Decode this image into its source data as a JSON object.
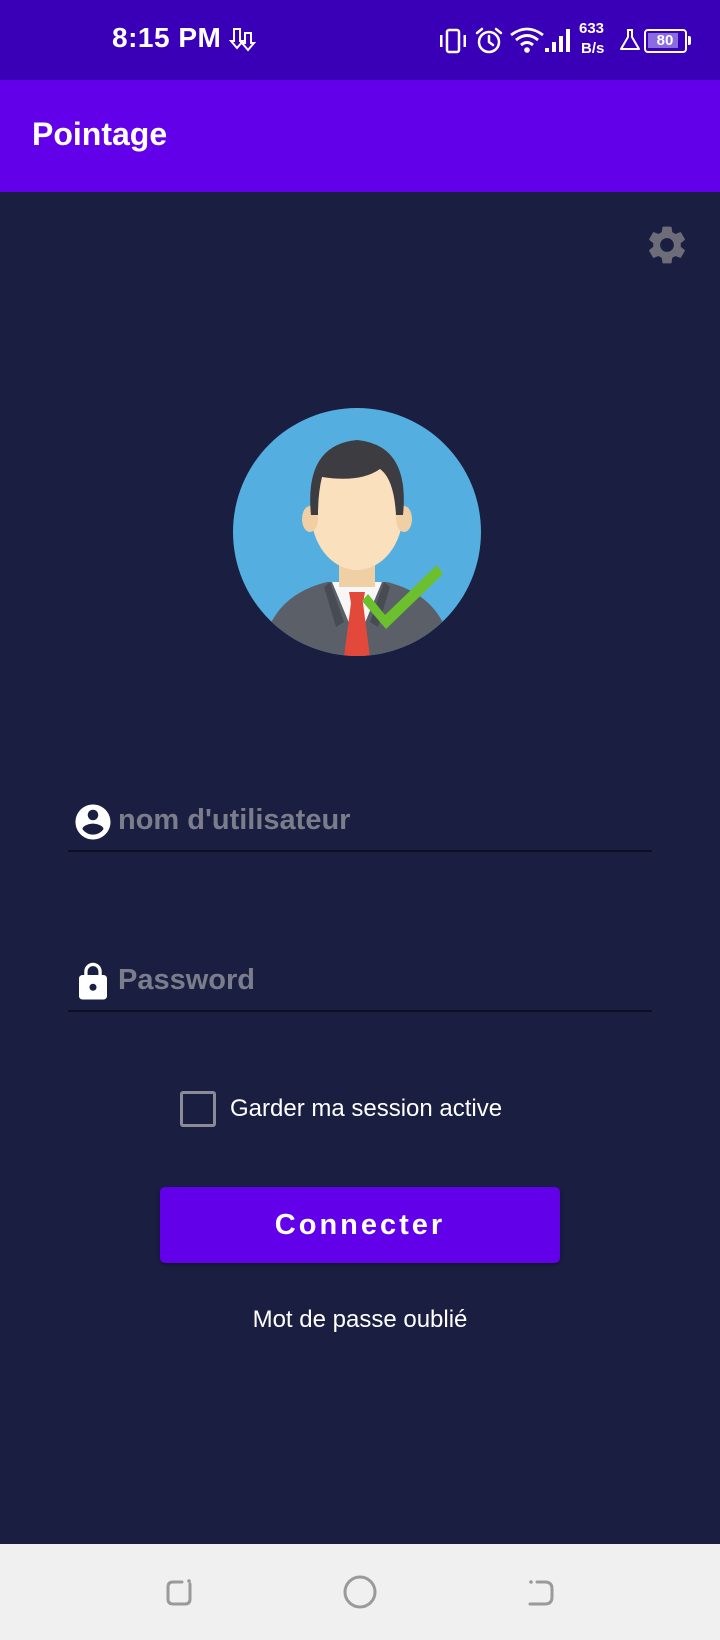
{
  "status_bar": {
    "time": "8:15 PM",
    "net_speed_value": "633",
    "net_speed_unit": "B/s",
    "battery": "80",
    "icons": [
      "download-arrows-icon",
      "vibrate-icon",
      "alarm-icon",
      "wifi-icon",
      "signal-icon",
      "flask-icon",
      "battery-icon"
    ]
  },
  "app_bar": {
    "title": "Pointage"
  },
  "settings": {
    "icon": "gear-icon"
  },
  "avatar": {
    "icon": "businessman-check-avatar"
  },
  "login": {
    "username_placeholder": "nom d'utilisateur",
    "username_icon": "account-circle-icon",
    "password_placeholder": "Password",
    "password_icon": "lock-icon",
    "remember_label": "Garder ma session active",
    "remember_checked": false,
    "connect_label": "Connecter",
    "forgot_label": "Mot de passe oublié"
  },
  "nav_bar": {
    "icons": [
      "recents-icon",
      "home-icon",
      "back-icon"
    ]
  },
  "colors": {
    "status_bar": "#3a00b8",
    "app_bar": "#6200ea",
    "background": "#1a1f42",
    "button": "#6200ea",
    "nav_bar": "#f0f0f0"
  }
}
